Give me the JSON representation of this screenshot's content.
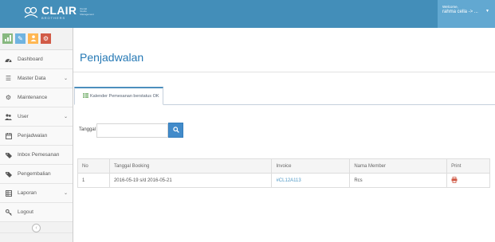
{
  "brand": {
    "name": "CLAIR",
    "sub": "BROTHERS",
    "tag": "Rental Studio Management"
  },
  "user_menu": {
    "greeting": "Welcome,",
    "user": "rahma cella -> ..."
  },
  "sidebar": {
    "shortcuts": [
      {
        "icon": "signal-icon",
        "color": "#87b87f"
      },
      {
        "icon": "pencil-icon",
        "color": "#6fb3e0"
      },
      {
        "icon": "users-icon",
        "color": "#ffb752"
      },
      {
        "icon": "cogs-icon",
        "color": "#d15b47"
      }
    ],
    "items": [
      {
        "label": "Dashboard",
        "icon": "tachometer-icon"
      },
      {
        "label": "Master Data",
        "icon": "list-icon"
      },
      {
        "label": "Maintenance",
        "icon": "cogs-icon"
      },
      {
        "label": "User",
        "icon": "users-icon"
      },
      {
        "label": "Penjadwalan",
        "icon": "calendar-icon"
      },
      {
        "label": "Inbox Pemesanan",
        "icon": "tag-icon"
      },
      {
        "label": "Pengembalian",
        "icon": "tag-icon"
      },
      {
        "label": "Laporan",
        "icon": "table-icon"
      },
      {
        "label": "Logout",
        "icon": "key-icon"
      }
    ]
  },
  "main": {
    "title": "Penjadwalan",
    "tab_label": "Kalender Pemesanan berstatus OK",
    "filter": {
      "label": "Tanggal :",
      "value": "",
      "placeholder": ""
    },
    "table": {
      "headers": [
        "No",
        "Tanggal Booking",
        "Invoice",
        "Nama Member",
        "Print"
      ],
      "rows": [
        {
          "no": "1",
          "tanggal": "2016-05-19 s/d 2016-05-21",
          "invoice": "#CL12A113",
          "member": "Rcs"
        }
      ]
    }
  },
  "colors": {
    "navbar": "#438eb9",
    "accent": "#2679b5",
    "primary_button": "#428bca",
    "print_icon": "#d15b47"
  }
}
